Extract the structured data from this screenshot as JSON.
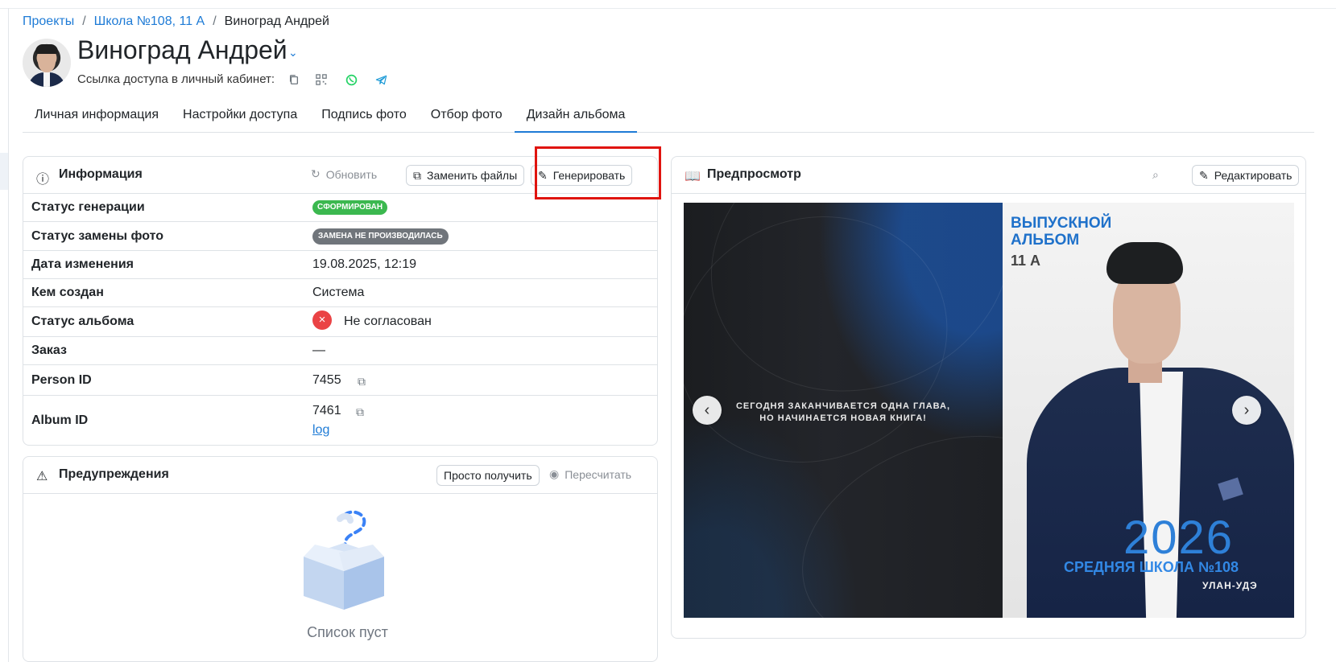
{
  "breadcrumb": {
    "items": [
      "Проекты",
      "Школа №108, 11 А",
      "Виноград Андрей"
    ],
    "separator": "/"
  },
  "person": {
    "name": "Виноград Андрей",
    "access_link_label": "Ссылка доступа в личный кабинет:"
  },
  "tabs": {
    "items": [
      {
        "label": "Личная информация"
      },
      {
        "label": "Настройки доступа"
      },
      {
        "label": "Подпись фото"
      },
      {
        "label": "Отбор фото"
      },
      {
        "label": "Дизайн альбома"
      }
    ],
    "active": "Дизайн альбома"
  },
  "info": {
    "title": "Информация",
    "refresh_label": "Обновить",
    "replace_files_label": "Заменить файлы",
    "generate_label": "Генерировать",
    "rows": [
      {
        "label": "Статус генерации",
        "value": "СФОРМИРОВАН"
      },
      {
        "label": "Статус замены фото",
        "value": "ЗАМЕНА НЕ ПРОИЗВОДИЛАСЬ"
      },
      {
        "label": "Дата изменения",
        "value": "19.08.2025, 12:19"
      },
      {
        "label": "Кем создан",
        "value": "Система"
      },
      {
        "label": "Статус альбома",
        "value": "Не согласован"
      },
      {
        "label": "Заказ",
        "value": "—"
      },
      {
        "label": "Person ID",
        "value": "7455"
      },
      {
        "label": "Album ID",
        "value": "7461",
        "link": "log"
      }
    ]
  },
  "warnings": {
    "title": "Предупреждения",
    "just_get_label": "Просто получить",
    "recalculate_label": "Пересчитать",
    "empty_text": "Список пуст"
  },
  "preview": {
    "title": "Предпросмотр",
    "edit_label": "Редактировать",
    "quote": "СЕГОДНЯ ЗАКАНЧИВАЕТСЯ ОДНА ГЛАВА,\nНО НАЧИНАЕТСЯ НОВАЯ КНИГА!",
    "album_title": "ВЫПУСКНОЙ АЛЬБОМ",
    "class_label": "11 А",
    "year": "2026",
    "school": "СРЕДНЯЯ ШКОЛА №108",
    "city": "УЛАН-УДЭ"
  },
  "colors": {
    "accent": "#1e7bd6",
    "success": "#3bb84f",
    "neutral_badge": "#70757b",
    "danger": "#ea4345",
    "highlight": "#e0140f",
    "whatsapp": "#25d366",
    "telegram": "#1e9bd7"
  },
  "icons": [
    "chevron-down-icon",
    "copy-icon",
    "qr-code-icon",
    "whatsapp-icon",
    "telegram-icon",
    "info-icon",
    "refresh-icon",
    "files-icon",
    "magic-wand-icon",
    "warning-icon",
    "eye-icon",
    "book-icon",
    "zoom-in-icon",
    "pencil-icon",
    "chevron-left-icon",
    "chevron-right-icon"
  ]
}
